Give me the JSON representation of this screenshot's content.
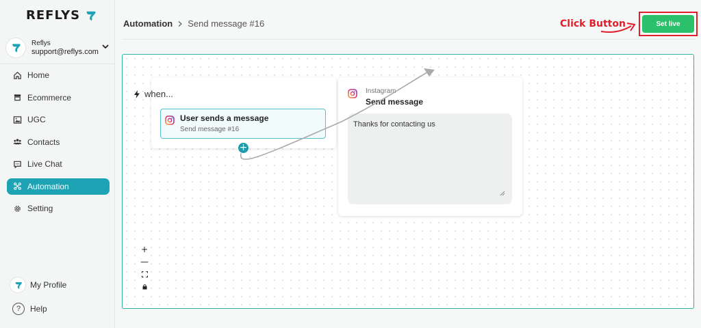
{
  "brand": {
    "name": "REFLYS"
  },
  "account": {
    "name": "Reflys",
    "email": "support@reflys.com"
  },
  "sidebar": {
    "items": [
      {
        "label": "Home",
        "icon": "home-icon"
      },
      {
        "label": "Ecommerce",
        "icon": "store-icon"
      },
      {
        "label": "UGC",
        "icon": "image-icon"
      },
      {
        "label": "Contacts",
        "icon": "users-icon"
      },
      {
        "label": "Live Chat",
        "icon": "chat-icon"
      },
      {
        "label": "Automation",
        "icon": "automation-icon",
        "active": true
      },
      {
        "label": "Setting",
        "icon": "gear-icon"
      }
    ],
    "profile_label": "My Profile",
    "help_label": "Help",
    "help_glyph": "?"
  },
  "header": {
    "breadcrumb_root": "Automation",
    "breadcrumb_current": "Send message #16",
    "set_live_label": "Set live",
    "annotation": "Click Button"
  },
  "canvas": {
    "trigger": {
      "when_label": "when...",
      "item_title": "User sends a message",
      "item_subtitle": "Send message #16"
    },
    "action": {
      "channel": "Instagram",
      "title": "Send message",
      "message": "Thanks for contacting us"
    },
    "zoom_controls": [
      "+",
      "—"
    ]
  },
  "colors": {
    "accent": "#1ea3b4",
    "set_live": "#2bc06a",
    "annotation_red": "#e11d2a",
    "canvas_border": "#2bb5a6"
  }
}
